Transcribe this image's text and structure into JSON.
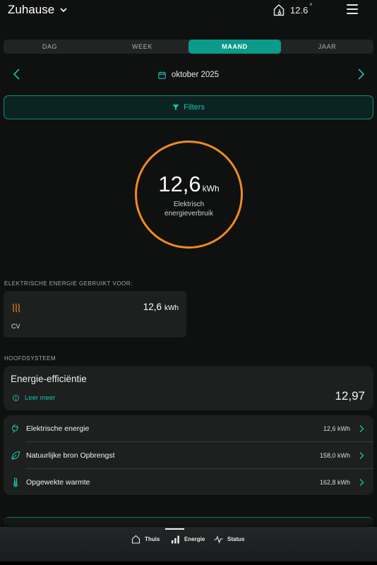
{
  "header": {
    "home_name": "Zuhause",
    "temperature": "12.6",
    "degree_symbol": "°"
  },
  "period_tabs": [
    {
      "label": "DAG",
      "active": false
    },
    {
      "label": "WEEK",
      "active": false
    },
    {
      "label": "MAAND",
      "active": true
    },
    {
      "label": "JAAR",
      "active": false
    }
  ],
  "month_nav": {
    "label": "oktober 2025"
  },
  "filters": {
    "label": "Filters"
  },
  "ring": {
    "value": "12,6",
    "unit": "kWh",
    "label": "Elektrisch energieverbruik",
    "color": "#f28a1e"
  },
  "used_for": {
    "section_label": "ELEKTRISCHE ENERGIE GEBRUIKT VOOR:",
    "item": {
      "name": "CV",
      "value": "12,6",
      "unit": "kWh",
      "icon": "heating-icon"
    }
  },
  "main_system": {
    "section_label": "HOOFDSYSTEEM",
    "efficiency": {
      "title": "Energie-efficiëntie",
      "info_link": "Leer meer",
      "value": "12,97"
    },
    "rows": [
      {
        "name": "Elektrische energie",
        "value": "12,6 kWh",
        "icon": "plug-icon"
      },
      {
        "name": "Natuurlijke bron Opbrengst",
        "value": "158,0 kWh",
        "icon": "leaf-icon"
      },
      {
        "name": "Opgewekte warmte",
        "value": "162,8 kWh",
        "icon": "thermometer-icon"
      }
    ]
  },
  "bottom_nav": [
    {
      "label": "Thuis",
      "icon": "home-icon",
      "active": false
    },
    {
      "label": "Energie",
      "icon": "bar-chart-icon",
      "active": true
    },
    {
      "label": "Status",
      "icon": "pulse-icon",
      "active": false
    }
  ],
  "colors": {
    "accent": "#0b9b8a",
    "accent_text": "#17c5b0",
    "ring": "#f28a1e",
    "background": "#0f1010"
  }
}
